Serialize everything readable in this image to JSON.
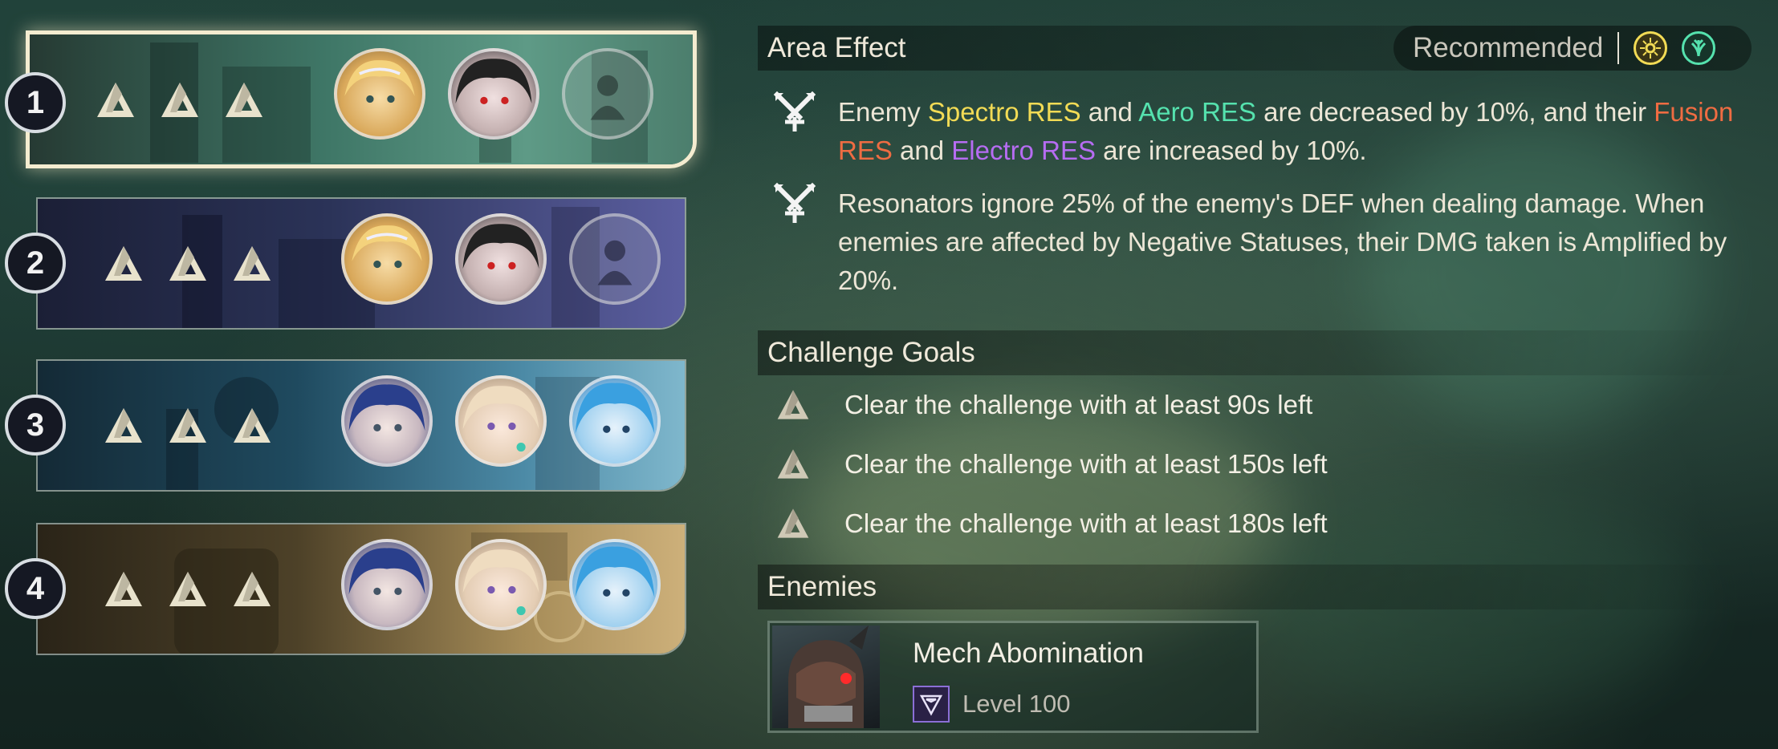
{
  "stages": [
    {
      "number": "1",
      "selected": true,
      "stars": 3,
      "portraits": [
        "blonde-resonator-portrait",
        "black-hair-resonator-portrait",
        "empty-slot-icon"
      ]
    },
    {
      "number": "2",
      "selected": false,
      "stars": 3,
      "portraits": [
        "blonde-resonator-portrait",
        "black-hair-resonator-portrait",
        "empty-slot-icon"
      ]
    },
    {
      "number": "3",
      "selected": false,
      "stars": 3,
      "portraits": [
        "blue-hair-resonator-portrait",
        "cream-hair-resonator-portrait",
        "light-blue-hair-resonator-portrait"
      ]
    },
    {
      "number": "4",
      "selected": false,
      "stars": 3,
      "portraits": [
        "blue-hair-resonator-portrait",
        "cream-hair-resonator-portrait",
        "light-blue-hair-resonator-portrait"
      ]
    }
  ],
  "area_effect": {
    "title": "Area Effect",
    "recommended_label": "Recommended",
    "recommended_elements": [
      {
        "icon": "spectro-element-icon",
        "color": "#f2db55"
      },
      {
        "icon": "aero-element-icon",
        "color": "#55e2ae"
      }
    ],
    "effect1": {
      "t1": "Enemy ",
      "spectro": "Spectro RES",
      "t2": " and ",
      "aero": "Aero RES",
      "t3": " are decreased by 10%, and their ",
      "fusion": "Fusion RES",
      "t4": " and ",
      "electro": "Electro RES",
      "t5": " are increased by 10%."
    },
    "effect2": "Resonators ignore 25% of the enemy's DEF when dealing damage. When enemies are affected by Negative Statuses, their DMG taken is Amplified by 20%."
  },
  "challenge_goals": {
    "title": "Challenge Goals",
    "items": [
      "Clear the challenge with at least 90s left",
      "Clear the challenge with at least 150s left",
      "Clear the challenge with at least 180s left"
    ]
  },
  "enemies": {
    "title": "Enemies",
    "list": [
      {
        "name": "Mech Abomination",
        "level": "Level 100"
      }
    ]
  },
  "colors": {
    "spectro": "#f2db55",
    "aero": "#55e2ae",
    "fusion": "#ef6c42",
    "electro": "#b66cf2",
    "selected_border": "#f4ecd0"
  }
}
